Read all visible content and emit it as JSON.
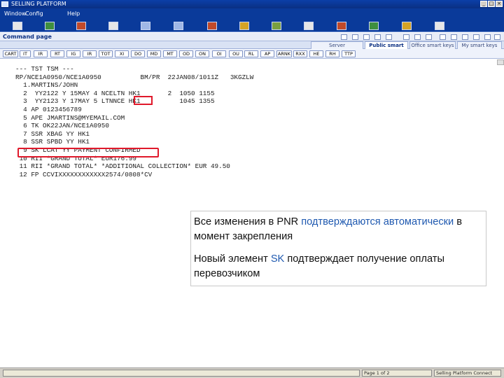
{
  "window": {
    "title": "SELLING PLATFORM"
  },
  "menu": {
    "items": [
      "Window",
      "Config",
      "Help"
    ]
  },
  "command_page": {
    "label": "Command page"
  },
  "tabs": [
    {
      "label": "Server"
    },
    {
      "label": "Public smart keys"
    },
    {
      "label": "Office smart keys"
    },
    {
      "label": "My smart keys"
    }
  ],
  "quick_buttons": [
    "CART",
    "IT",
    "IR",
    "RT",
    "IG",
    "IR",
    "TOT",
    "XI",
    "DO",
    "MD",
    "MT",
    "OD",
    "ON",
    "OI",
    "OU",
    "RL",
    "AP",
    "ARNK",
    "RXX",
    "HE",
    "RH",
    "TTP"
  ],
  "pnr_lines": [
    "--- TST TSM ---",
    "RP/NCE1A0950/NCE1A0950          BM/PR  22JAN08/1011Z   3KGZLW",
    "  1.MARTINS/JOHN",
    "  2  YY2122 Y 15MAY 4 NCELTN HK1       2  1050 1155",
    "  3  YY2123 Y 17MAY 5 LTNNCE HK1          1045 1355",
    "  4 AP 0123456789",
    "  5 APE JMARTINS@MYEMAIL.COM",
    "  6 TK OK22JAN/NCE1A0950",
    "  7 SSR XBAG YY HK1",
    "  8 SSR SPBD YY HK1",
    "  9 SK LCAT YY PAYMENT CONFIRMED",
    " 10 RII *GRAND TOTAL* EUR176.99",
    " 11 RII *GRAND TOTAL* *ADDITIONAL COLLECTION* EUR 49.50",
    " 12 FP CCVIXXXXXXXXXXXX2574/0808*CV"
  ],
  "note": {
    "p1_a": "Все изменения в PNR ",
    "p1_b": "подтверждаются",
    "p1_c": " ",
    "p1_d": "автоматически",
    "p1_e": " в момент закрепления",
    "p2_a": "Новый элемент ",
    "p2_b": "SK",
    "p2_c": " подтверждает получение оплаты перевозчиком"
  },
  "status": {
    "page": "Page 1 of 2",
    "app": "Selling Platform Connect"
  },
  "colors": {
    "titlebar": "#0a3a9a",
    "highlight_box": "#e0192b",
    "keyword_blue": "#1f59b0"
  }
}
